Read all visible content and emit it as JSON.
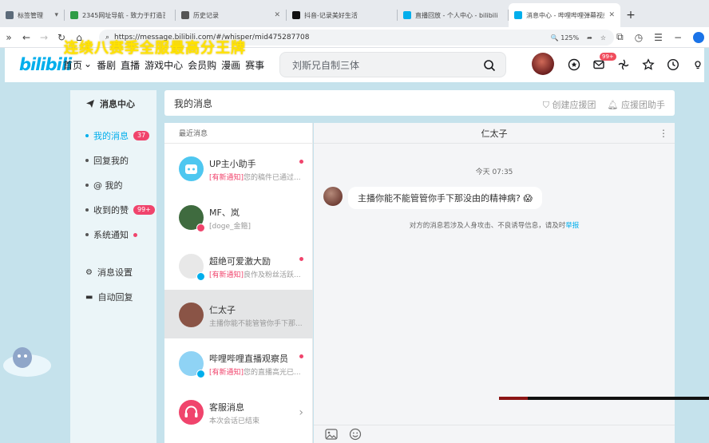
{
  "browser": {
    "tabs": [
      {
        "label": "标签管理",
        "fav_color": "#5c6b7a",
        "has_dropdown": true
      },
      {
        "label": "2345网址导航 - 致力于打造百年",
        "fav_color": "#2f9c46"
      },
      {
        "label": "历史记录",
        "fav_color": "#555555",
        "has_close": true
      },
      {
        "label": "抖音-记录美好生活",
        "fav_color": "#111111"
      },
      {
        "label": "直播回放 - 个人中心 - bilibili li",
        "fav_color": "#00aeec"
      },
      {
        "label": "消息中心 - 哔哩哔哩弹幕视频",
        "fav_color": "#00aeec",
        "active": true
      }
    ],
    "url": "https://message.bilibili.com/#/whisper/mid475287708",
    "zoom": "125%"
  },
  "overlay_text": "连续八赛季全服最高分王牌",
  "header": {
    "logo_text": "bilibili",
    "nav": [
      "首页",
      "番剧",
      "直播",
      "游戏中心",
      "会员购",
      "漫画",
      "赛事"
    ],
    "search_placeholder": "刘斯兄自制三体",
    "message_badge": "99+"
  },
  "sidebar": {
    "title": "消息中心",
    "items": [
      {
        "label": "我的消息",
        "badge": "37",
        "active": true
      },
      {
        "label": "回复我的"
      },
      {
        "label": "@ 我的"
      },
      {
        "label": "收到的赞",
        "badge": "99+"
      },
      {
        "label": "系统通知",
        "dot": true
      }
    ],
    "settings": [
      {
        "label": "消息设置",
        "icon": "gear-icon"
      },
      {
        "label": "自动回复",
        "icon": "chat-icon"
      }
    ]
  },
  "topbar": {
    "title": "我的消息",
    "actions": [
      "创建应援团",
      "应援团助手"
    ]
  },
  "sessions": {
    "header": "最近消息",
    "items": [
      {
        "name": "UP主小助手",
        "tag": "[有新通知]",
        "preview": "您的稿件已通过...",
        "unread": true,
        "avatar": "#4ec7f0"
      },
      {
        "name": "MF、岚",
        "tag": "",
        "preview": "[doge_金箍]",
        "avatar": "#3f6b3f"
      },
      {
        "name": "超绝可爱激大励",
        "tag": "[有新通知]",
        "preview": "良作及粉丝活跃...",
        "unread": true,
        "avatar": "#e8e8e8"
      },
      {
        "name": "仁太子",
        "tag": "",
        "preview": "主播你能不能管管你手下那...",
        "active": true,
        "avatar": "#8a5446"
      },
      {
        "name": "哔哩哔哩直播观察员",
        "tag": "[有新通知]",
        "preview": "您的直播高光已...",
        "unread": true,
        "avatar": "#8fd3f5"
      },
      {
        "name": "客服消息",
        "tag": "",
        "preview": "本次会话已结束",
        "avatar": "#f0446c",
        "chevron": true
      }
    ]
  },
  "chat": {
    "title": "仁太子",
    "time": "今天 07:35",
    "message": "主播你能不能管管你手下那没由的精神病?",
    "emoji": "😱",
    "notice": "对方的消息若涉及人身攻击、不良诱导信息，请及时",
    "notice_link": "举报"
  }
}
